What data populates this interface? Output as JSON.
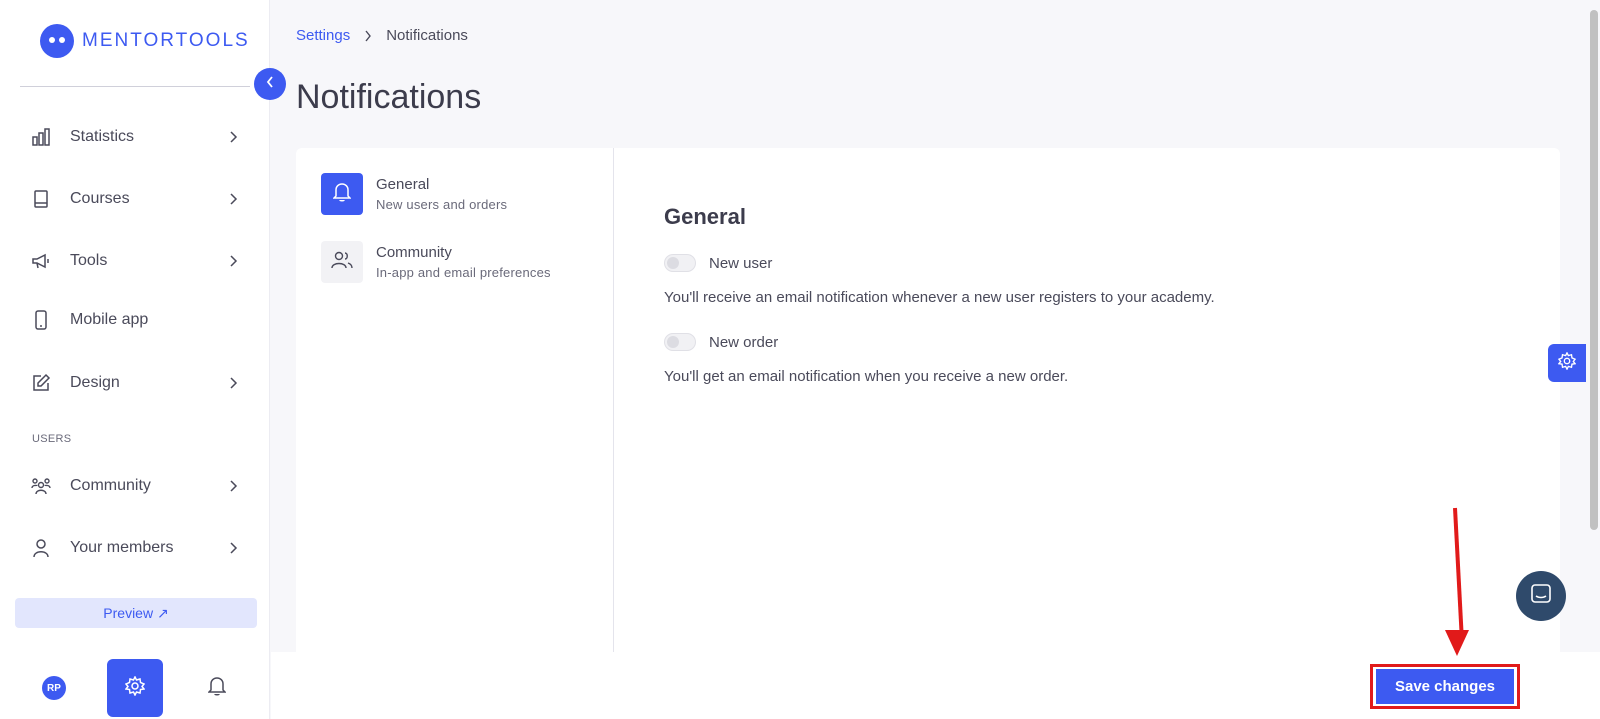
{
  "brand": {
    "name": "MENTORTOOLS"
  },
  "sidebar": {
    "items": [
      {
        "label": "Statistics",
        "icon": "bar-chart-icon",
        "has_chevron": true
      },
      {
        "label": "Courses",
        "icon": "book-icon",
        "has_chevron": true
      },
      {
        "label": "Tools",
        "icon": "megaphone-icon",
        "has_chevron": true
      },
      {
        "label": "Mobile app",
        "icon": "phone-icon",
        "has_chevron": false
      },
      {
        "label": "Design",
        "icon": "pencil-icon",
        "has_chevron": true
      }
    ],
    "users_section_label": "USERS",
    "users_items": [
      {
        "label": "Community",
        "icon": "people-icon",
        "has_chevron": true
      },
      {
        "label": "Your members",
        "icon": "person-icon",
        "has_chevron": true
      }
    ],
    "preview_label": "Preview ↗",
    "avatar_initials": "RP"
  },
  "breadcrumb": {
    "parent": "Settings",
    "current": "Notifications"
  },
  "page": {
    "title": "Notifications"
  },
  "settings_menu": [
    {
      "title": "General",
      "subtitle": "New users and orders",
      "active": true
    },
    {
      "title": "Community",
      "subtitle": "In-app and email preferences",
      "active": false
    }
  ],
  "general": {
    "title": "General",
    "toggles": [
      {
        "label": "New user",
        "enabled": false,
        "description": "You'll receive an email notification whenever a new user registers to your academy."
      },
      {
        "label": "New order",
        "enabled": false,
        "description": "You'll get an email notification when you receive a new order."
      }
    ]
  },
  "footer": {
    "save_label": "Save changes"
  },
  "colors": {
    "accent": "#3d5af1",
    "highlight": "#e11a1a",
    "chat": "#2f4a6b"
  }
}
